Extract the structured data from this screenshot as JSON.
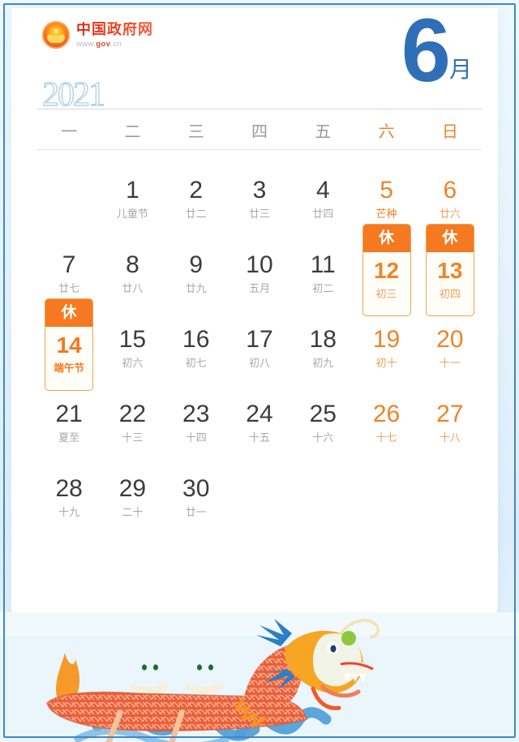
{
  "brand": {
    "emblem_icon": "china-national-emblem-icon",
    "name": "中国政府网",
    "url_prefix": "www.",
    "url_mid": "gov",
    "url_suffix": ".cn",
    "name_color": "#d93a1c"
  },
  "header": {
    "year": "2021",
    "month_number": "6",
    "month_unit": "月",
    "month_color": "#2f6fb8",
    "year_outline_color": "#a8cbe6"
  },
  "weekdays": [
    {
      "label": "一",
      "weekend": false
    },
    {
      "label": "二",
      "weekend": false
    },
    {
      "label": "三",
      "weekend": false
    },
    {
      "label": "四",
      "weekend": false
    },
    {
      "label": "五",
      "weekend": false
    },
    {
      "label": "六",
      "weekend": true
    },
    {
      "label": "日",
      "weekend": true
    }
  ],
  "colors": {
    "weekend": "#f08327",
    "holiday_orange": "#f47920",
    "holiday_border": "#f0a44e",
    "weekday_gray": "#9b9b9b",
    "lunar_gray": "#a9a9a9",
    "card_bg": "#ffffff",
    "page_bg": "#eaf5fc",
    "frame_border": "#3f86c9"
  },
  "holiday_tag_label": "休",
  "weeks": [
    [
      {
        "empty": true
      },
      {
        "day": "1",
        "lunar": "儿童节",
        "weekend": false,
        "holiday": false,
        "term": false
      },
      {
        "day": "2",
        "lunar": "廿二",
        "weekend": false,
        "holiday": false,
        "term": false
      },
      {
        "day": "3",
        "lunar": "廿三",
        "weekend": false,
        "holiday": false,
        "term": false
      },
      {
        "day": "4",
        "lunar": "廿四",
        "weekend": false,
        "holiday": false,
        "term": false
      },
      {
        "day": "5",
        "lunar": "芒种",
        "weekend": true,
        "holiday": false,
        "term": true
      },
      {
        "day": "6",
        "lunar": "廿六",
        "weekend": true,
        "holiday": false,
        "term": false
      }
    ],
    [
      {
        "day": "7",
        "lunar": "廿七",
        "weekend": false,
        "holiday": false,
        "term": false
      },
      {
        "day": "8",
        "lunar": "廿八",
        "weekend": false,
        "holiday": false,
        "term": false
      },
      {
        "day": "9",
        "lunar": "廿九",
        "weekend": false,
        "holiday": false,
        "term": false
      },
      {
        "day": "10",
        "lunar": "五月",
        "weekend": false,
        "holiday": false,
        "term": false
      },
      {
        "day": "11",
        "lunar": "初二",
        "weekend": false,
        "holiday": false,
        "term": false
      },
      {
        "day": "12",
        "lunar": "初三",
        "weekend": true,
        "holiday": true,
        "term": false
      },
      {
        "day": "13",
        "lunar": "初四",
        "weekend": true,
        "holiday": true,
        "term": false
      }
    ],
    [
      {
        "day": "14",
        "lunar": "端午节",
        "weekend": false,
        "holiday": true,
        "festival": true,
        "term": false
      },
      {
        "day": "15",
        "lunar": "初六",
        "weekend": false,
        "holiday": false,
        "term": false
      },
      {
        "day": "16",
        "lunar": "初七",
        "weekend": false,
        "holiday": false,
        "term": false
      },
      {
        "day": "17",
        "lunar": "初八",
        "weekend": false,
        "holiday": false,
        "term": false
      },
      {
        "day": "18",
        "lunar": "初九",
        "weekend": false,
        "holiday": false,
        "term": false
      },
      {
        "day": "19",
        "lunar": "初十",
        "weekend": true,
        "holiday": false,
        "term": false
      },
      {
        "day": "20",
        "lunar": "十一",
        "weekend": true,
        "holiday": false,
        "term": false
      }
    ],
    [
      {
        "day": "21",
        "lunar": "夏至",
        "weekend": false,
        "holiday": false,
        "term": false
      },
      {
        "day": "22",
        "lunar": "十三",
        "weekend": false,
        "holiday": false,
        "term": false
      },
      {
        "day": "23",
        "lunar": "十四",
        "weekend": false,
        "holiday": false,
        "term": false
      },
      {
        "day": "24",
        "lunar": "十五",
        "weekend": false,
        "holiday": false,
        "term": false
      },
      {
        "day": "25",
        "lunar": "十六",
        "weekend": false,
        "holiday": false,
        "term": false
      },
      {
        "day": "26",
        "lunar": "十七",
        "weekend": true,
        "holiday": false,
        "term": false
      },
      {
        "day": "27",
        "lunar": "十八",
        "weekend": true,
        "holiday": false,
        "term": false
      }
    ],
    [
      {
        "day": "28",
        "lunar": "十九",
        "weekend": false,
        "holiday": false,
        "term": false
      },
      {
        "day": "29",
        "lunar": "二十",
        "weekend": false,
        "holiday": false,
        "term": false
      },
      {
        "day": "30",
        "lunar": "廿一",
        "weekend": false,
        "holiday": false,
        "term": false
      },
      {
        "empty": true
      },
      {
        "empty": true
      },
      {
        "empty": true
      },
      {
        "empty": true
      }
    ]
  ],
  "illustration": {
    "name": "dragon-boat-illustration",
    "elements": [
      "dragon-boat",
      "dragon-head",
      "zongzi-character",
      "zongzi-character",
      "flame-tail",
      "blue-wave",
      "far-mountains"
    ]
  }
}
